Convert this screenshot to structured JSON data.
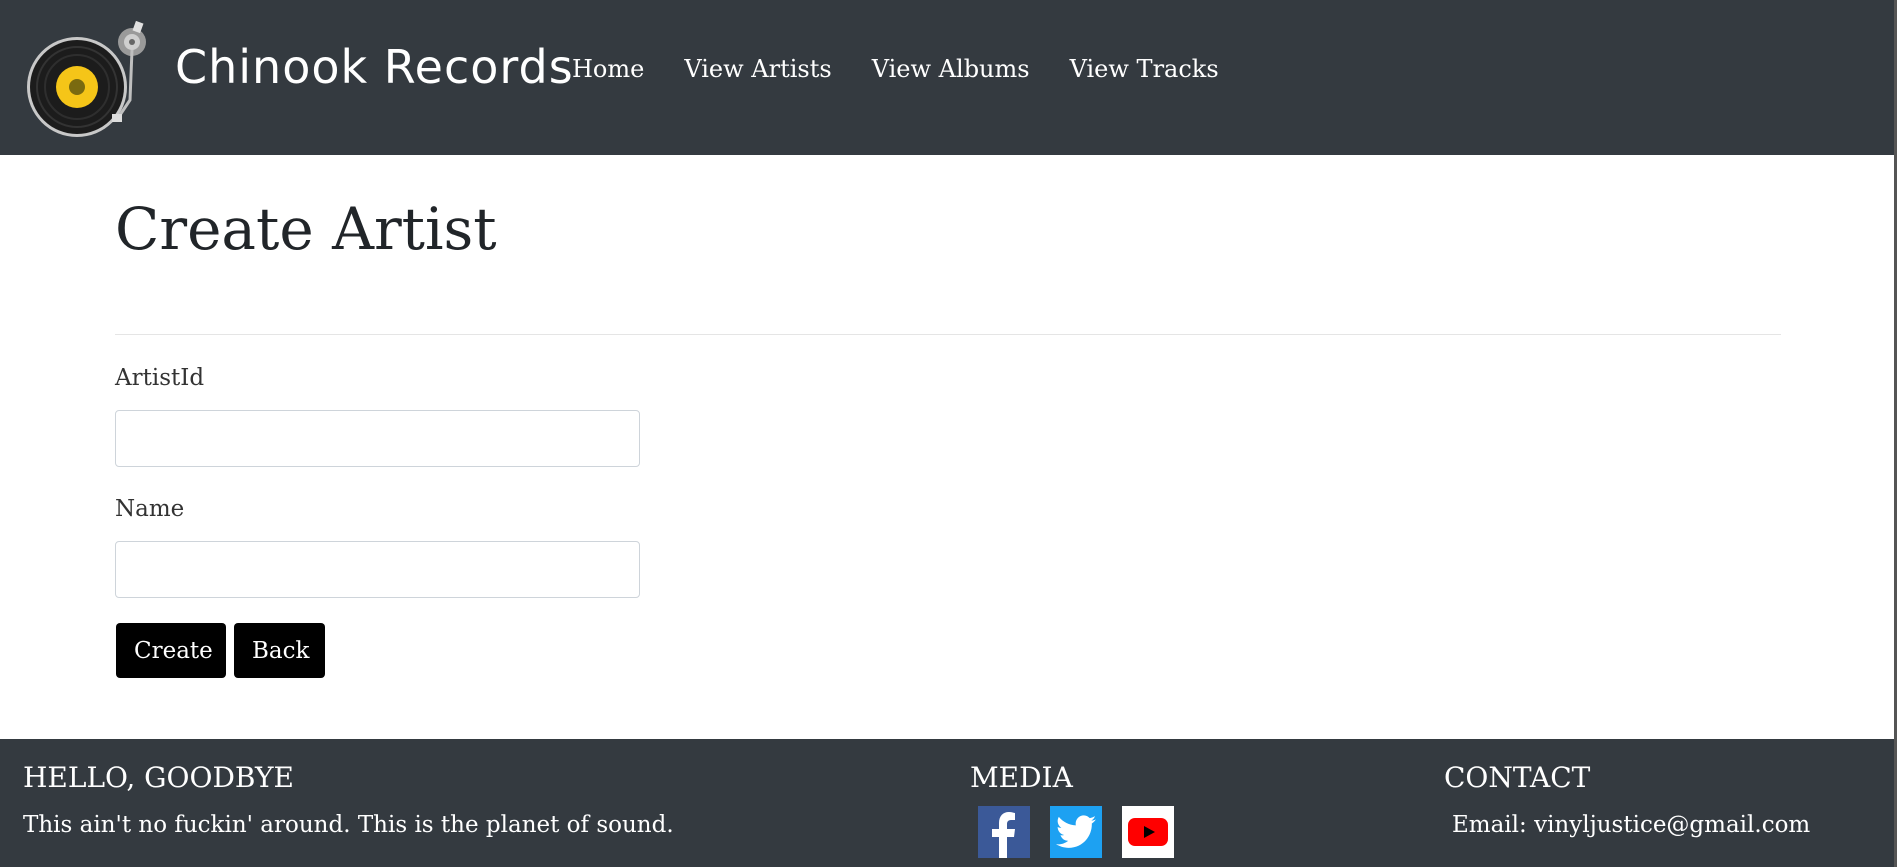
{
  "navbar": {
    "brand": "Chinook Records",
    "logo_icon": "vinyl-record-icon",
    "links": [
      "Home",
      "View Artists",
      "View Albums",
      "View Tracks"
    ]
  },
  "main": {
    "title": "Create Artist",
    "fields": [
      {
        "label": "ArtistId",
        "value": "",
        "placeholder": ""
      },
      {
        "label": "Name",
        "value": "",
        "placeholder": ""
      }
    ],
    "buttons": {
      "create": "Create",
      "back": "Back"
    }
  },
  "footer": {
    "hello": {
      "heading": "HELLO, GOODBYE",
      "text": "This ain't no fuckin' around. This is the planet of sound."
    },
    "media": {
      "heading": "MEDIA",
      "icons": [
        "facebook-icon",
        "twitter-icon",
        "youtube-icon"
      ]
    },
    "contact": {
      "heading": "CONTACT",
      "text": "Email: vinyljustice@gmail.com"
    }
  },
  "colors": {
    "navbar_bg": "#343a40",
    "button_bg": "#000000",
    "facebook": "#3b5998",
    "twitter": "#1da1f2",
    "youtube": "#ff0000",
    "logo_accent": "#f5c518"
  }
}
